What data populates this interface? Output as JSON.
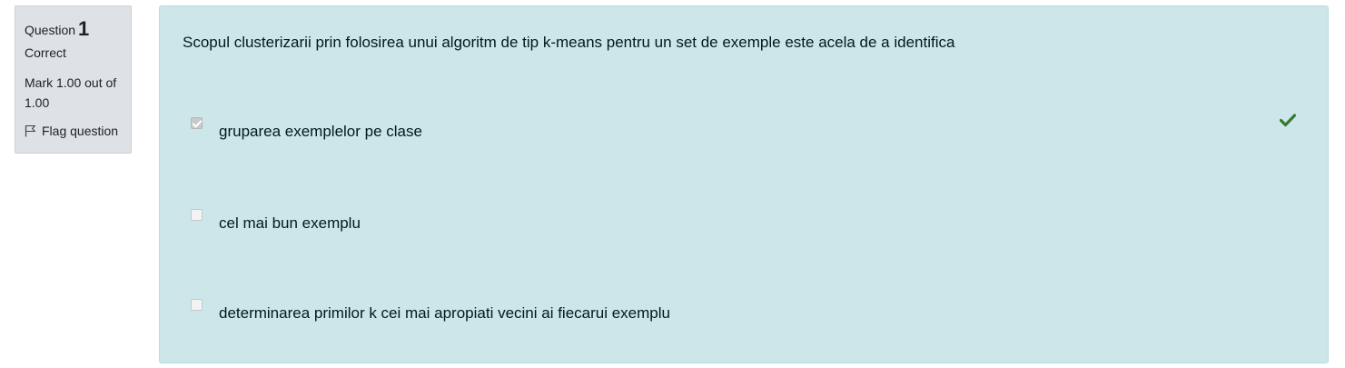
{
  "info": {
    "question_label": "Question",
    "question_number": "1",
    "state": "Correct",
    "grade": "Mark 1.00 out of 1.00",
    "flag_label": "Flag question"
  },
  "question": {
    "text": "Scopul clusterizarii prin folosirea unui algoritm de tip k-means pentru un set de exemple este acela de a identifica",
    "options": [
      {
        "label": "gruparea exemplelor pe clase",
        "checked": true,
        "correct": true
      },
      {
        "label": "cel mai bun exemplu",
        "checked": false,
        "correct": false
      },
      {
        "label": "determinarea primilor k cei mai apropiati vecini ai fiecarui exemplu",
        "checked": false,
        "correct": false
      }
    ]
  },
  "colors": {
    "info_bg": "#dee2e6",
    "content_bg": "#cce6ea",
    "correct_check": "#357a32"
  },
  "icons": {
    "flag": "flag-icon",
    "correct": "check-icon"
  }
}
